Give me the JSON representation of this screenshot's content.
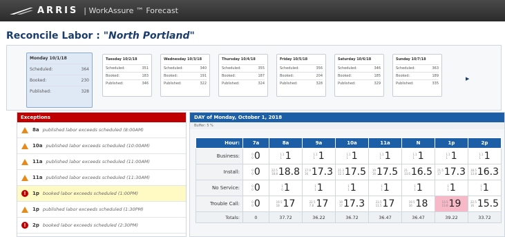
{
  "header": {
    "brand": "ARRIS",
    "app": "| WorkAssure ™ Forecast"
  },
  "title": {
    "prefix": "Reconcile Labor : ",
    "location": "\"North Portland\""
  },
  "days": [
    {
      "label": "Monday 10/1/18",
      "rows": [
        [
          "Scheduled:",
          "364"
        ],
        [
          "Booked:",
          "230"
        ],
        [
          "Published:",
          "328"
        ]
      ]
    },
    {
      "label": "Tuesday 10/2/18",
      "rows": [
        [
          "Scheduled:",
          "351"
        ],
        [
          "Booked:",
          "183"
        ],
        [
          "Published:",
          "346"
        ]
      ]
    },
    {
      "label": "Wednesday 10/3/18",
      "rows": [
        [
          "Scheduled:",
          "340"
        ],
        [
          "Booked:",
          "191"
        ],
        [
          "Published:",
          "322"
        ]
      ]
    },
    {
      "label": "Thursday 10/4/18",
      "rows": [
        [
          "Scheduled:",
          "355"
        ],
        [
          "Booked:",
          "187"
        ],
        [
          "Published:",
          "324"
        ]
      ]
    },
    {
      "label": "Friday 10/5/18",
      "rows": [
        [
          "Scheduled:",
          "356"
        ],
        [
          "Booked:",
          "204"
        ],
        [
          "Published:",
          "328"
        ]
      ]
    },
    {
      "label": "Saturday 10/6/18",
      "rows": [
        [
          "Scheduled:",
          "346"
        ],
        [
          "Booked:",
          "185"
        ],
        [
          "Published:",
          "329"
        ]
      ]
    },
    {
      "label": "Sunday 10/7/18",
      "rows": [
        [
          "Scheduled:",
          "363"
        ],
        [
          "Booked:",
          "189"
        ],
        [
          "Published:",
          "335"
        ]
      ]
    }
  ],
  "exceptions": {
    "header": "Exceptions",
    "items": [
      {
        "time": "8a",
        "msg": "published labor exceeds scheduled (8:00AM)",
        "type": "warn"
      },
      {
        "time": "10a",
        "msg": "published labor exceeds scheduled (10:00AM)",
        "type": "warn"
      },
      {
        "time": "11a",
        "msg": "published labor exceeds scheduled (11:00AM)",
        "type": "warn"
      },
      {
        "time": "11a",
        "msg": "published labor exceeds scheduled (11:30AM)",
        "type": "warn"
      },
      {
        "time": "1p",
        "msg": "booked labor exceeds scheduled (1:00PM)",
        "type": "err"
      },
      {
        "time": "1p",
        "msg": "published labor exceeds scheduled (1:30PM)",
        "type": "warn"
      },
      {
        "time": "2p",
        "msg": "booked labor exceeds scheduled (2:30PM)",
        "type": "err"
      }
    ]
  },
  "day_detail": {
    "header": "DAY of Monday, October 1, 2018",
    "buffer": "Buffer: 5 %",
    "hour_label": "Hour:",
    "hours": [
      "7a",
      "8a",
      "9a",
      "10a",
      "11a",
      "N",
      "1p",
      "2p"
    ],
    "rows": [
      {
        "label": "Business:",
        "cells": [
          [
            "0",
            "0",
            "0"
          ],
          [
            "1.1",
            "1",
            "1"
          ],
          [
            "1.1",
            "1",
            "1"
          ],
          [
            "1.1",
            "1",
            "1"
          ],
          [
            "1.1",
            "1",
            "1"
          ],
          [
            "1.1",
            "1",
            "1"
          ],
          [
            "1.1",
            "1",
            "1"
          ],
          [
            "1.1",
            "1",
            "1"
          ]
        ]
      },
      {
        "label": "Install:",
        "cells": [
          [
            "0",
            "0",
            "0"
          ],
          [
            "22.5",
            "18.8",
            "18.8"
          ],
          [
            "17.9",
            "16",
            "17.3"
          ],
          [
            "21.3",
            "12.3",
            "17.5"
          ],
          [
            "19",
            "16",
            "17.5"
          ],
          [
            "21",
            "13.6",
            "16.5"
          ],
          [
            "21.5",
            "17",
            "17.3"
          ],
          [
            "18.5",
            "13.8",
            "16.3"
          ]
        ]
      },
      {
        "label": "No Service:",
        "cells": [
          [
            "0",
            "0",
            "0"
          ],
          [
            "1",
            "0",
            "1"
          ],
          [
            "1",
            "1",
            "1"
          ],
          [
            "1",
            "1",
            "1"
          ],
          [
            "1",
            "1",
            "1"
          ],
          [
            "1",
            "1",
            "1"
          ],
          [
            "1",
            "1",
            "1"
          ],
          [
            "1",
            "1",
            "1"
          ]
        ]
      },
      {
        "label": "Trouble Call:",
        "cells": [
          [
            "0",
            "0",
            "0"
          ],
          [
            "19.5",
            "18",
            "17"
          ],
          [
            "22.5",
            "7.8",
            "17"
          ],
          [
            "19",
            "17",
            "17.3"
          ],
          [
            "23.5",
            "11.5",
            "17"
          ],
          [
            "19.5",
            "16",
            "18"
          ],
          [
            "13.5",
            "13.8",
            "19"
          ],
          [
            "22.5",
            "16",
            "15.5"
          ]
        ]
      }
    ],
    "totals_label": "Totals:",
    "totals": [
      "0",
      "37.72",
      "36.22",
      "36.72",
      "36.47",
      "36.47",
      "39.22",
      "33.72"
    ]
  }
}
